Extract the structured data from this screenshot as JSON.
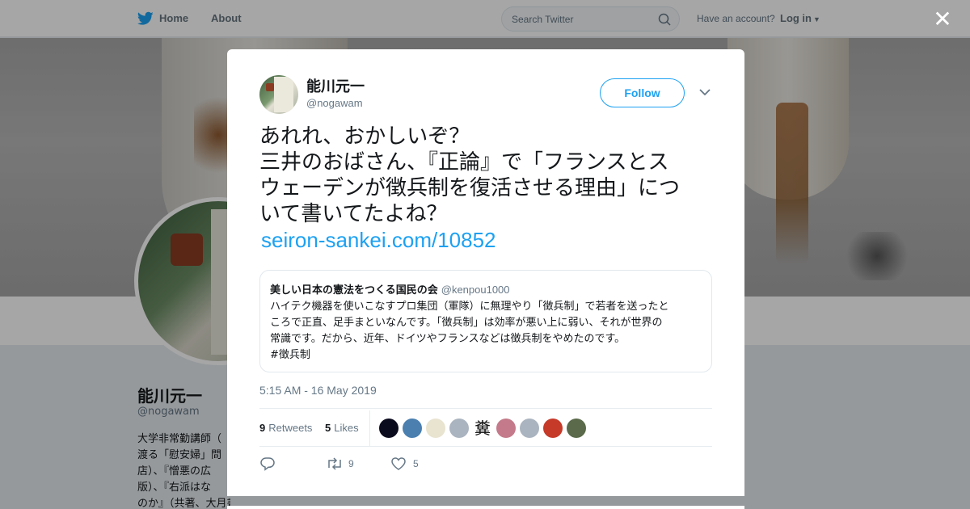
{
  "nav": {
    "home_label": "Home",
    "about_label": "About",
    "search_placeholder": "Search Twitter",
    "account_prompt": "Have an account?",
    "login_label": "Log in"
  },
  "profile": {
    "name": "能川元一",
    "handle": "@nogawam",
    "bio_lines": [
      "大学非常勤講師（",
      "渡る「慰安婦」問",
      "店）、『憎悪の広",
      "版）、『右派はな",
      "のか』（共著、大月書店）、『まぼろし"
    ]
  },
  "tweet": {
    "author_name": "能川元一",
    "author_handle": "@nogawam",
    "follow_label": "Follow",
    "text_lines": [
      "あれれ、おかしいぞ？",
      "三井のおばさん、『正論』で「フランスとス",
      "ウェーデンが徴兵制を復活させる理由」につ",
      "いて書いてたよね？"
    ],
    "link": "seiron-sankei.com/10852",
    "quote": {
      "name": "美しい日本の憲法をつくる国民の会",
      "handle": "@kenpou1000",
      "lines": [
        "ハイテク機器を使いこなすプロ集団（軍隊）に無理やり「徴兵制」で若者を送ったと",
        "ころで正直、足手まといなんです。「徴兵制」は効率が悪い上に弱い、それが世界の",
        "常識です。だから、近年、ドイツやフランスなどは徴兵制をやめたのです。",
        "#徴兵制"
      ]
    },
    "timestamp": "5:15 AM - 16 May 2019",
    "retweets_count": "9",
    "retweets_label": "Retweets",
    "likes_count": "5",
    "likes_label": "Likes",
    "liker_avatar_colors": [
      "#0b0b1e",
      "#4a7fb0",
      "#e8e4d0",
      "#aab4c0",
      "#ffffff",
      "#c47a8a",
      "#aab4c0",
      "#c63a2a",
      "#5a6a4a"
    ],
    "liker_avatar_glyph": "糞",
    "action_retweet_count": "9",
    "action_like_count": "5"
  },
  "colors": {
    "accent": "#1da1f2",
    "muted": "#657786",
    "text": "#14171a"
  },
  "icons": [
    "twitter-bird-icon",
    "search-icon",
    "caret-down-icon",
    "close-icon",
    "reply-icon",
    "retweet-icon",
    "heart-icon"
  ]
}
